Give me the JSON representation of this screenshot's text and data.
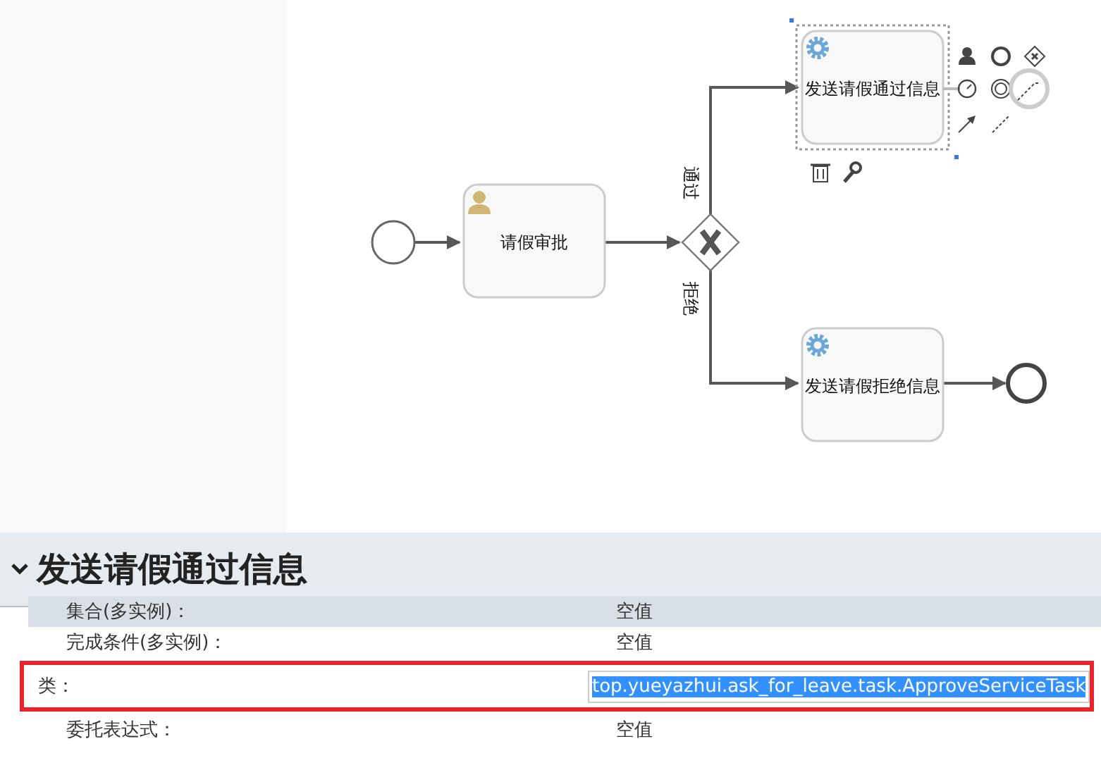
{
  "diagram": {
    "nodes": [
      {
        "kind": "start",
        "selected": false
      },
      {
        "kind": "user-task",
        "label": "请假审批",
        "selected": false
      },
      {
        "kind": "gateway",
        "selected": false
      },
      {
        "kind": "service-task",
        "label": "发送请假通过信息",
        "selected": true
      },
      {
        "kind": "service-task",
        "label": "发送请假拒绝信息",
        "selected": false
      },
      {
        "kind": "end",
        "selected": false
      }
    ],
    "flows": [
      {
        "label": "通过"
      },
      {
        "label": "拒绝"
      }
    ]
  },
  "panel": {
    "title": "发送请假通过信息",
    "expanded": true,
    "rows": [
      {
        "label": "集合(多实例)：",
        "value": "空值",
        "kind": "text",
        "hovered": true,
        "highlighted": false
      },
      {
        "label": "完成条件(多实例)：",
        "value": "空值",
        "kind": "text",
        "hovered": false,
        "highlighted": false
      },
      {
        "label": "类：",
        "value": "top.yueyazhui.ask_for_leave.task.ApproveServiceTask",
        "kind": "input",
        "hovered": false,
        "highlighted": true,
        "text_selected": true
      },
      {
        "label": "委托表达式：",
        "value": "空值",
        "kind": "text",
        "hovered": false,
        "highlighted": false
      }
    ]
  }
}
